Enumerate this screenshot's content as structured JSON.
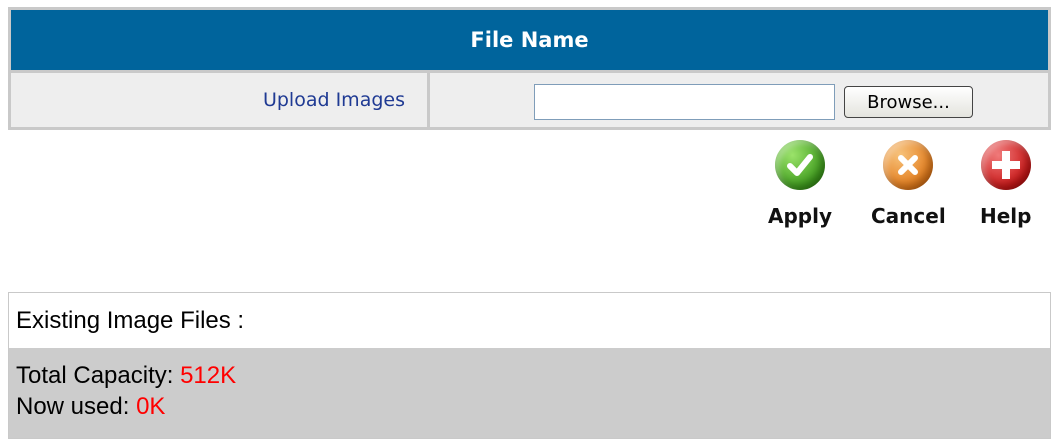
{
  "upload_table": {
    "header": "File Name",
    "row_label": "Upload Images",
    "file_input_value": "",
    "browse_label": "Browse..."
  },
  "actions": [
    {
      "label": "Apply",
      "icon": "checkmark-icon",
      "color": "#3d9a1c"
    },
    {
      "label": "Cancel",
      "icon": "x-icon",
      "color": "#e27a1a"
    },
    {
      "label": "Help",
      "icon": "plus-icon",
      "color": "#c81616"
    }
  ],
  "existing": {
    "title": "Existing Image Files :",
    "total_capacity_label": "Total Capacity:",
    "total_capacity_value": "512K",
    "now_used_label": "Now used:",
    "now_used_value": "0K"
  },
  "colors": {
    "header_bg": "#00649c",
    "value_highlight": "#ff0000"
  }
}
